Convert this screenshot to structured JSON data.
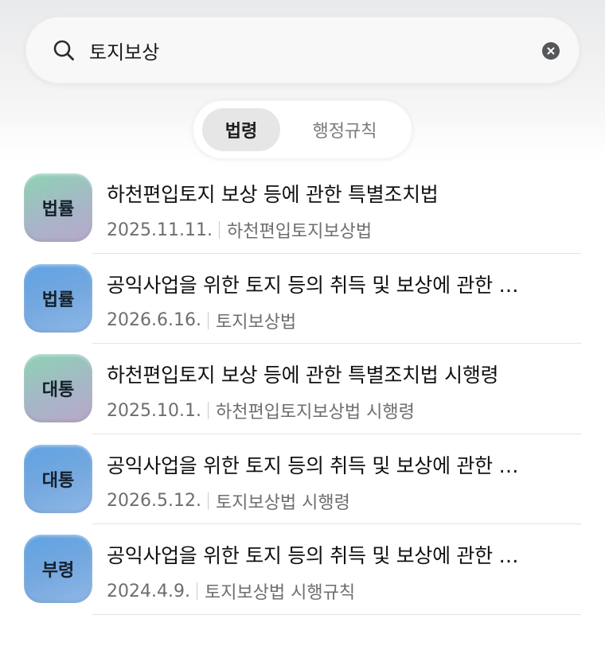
{
  "search": {
    "value": "토지보상",
    "placeholder": ""
  },
  "tabs": [
    {
      "label": "법령",
      "selected": true
    },
    {
      "label": "행정규칙",
      "selected": false
    }
  ],
  "results": [
    {
      "badge": "법률",
      "badge_color": "green",
      "title": "하천편입토지 보상 등에 관한 특별조치법",
      "date": "2025.11.11.",
      "short_name": "하천편입토지보상법"
    },
    {
      "badge": "법률",
      "badge_color": "blue",
      "title": "공익사업을 위한 토지 등의 취득 및 보상에 관한 …",
      "date": "2026.6.16.",
      "short_name": "토지보상법"
    },
    {
      "badge": "대통",
      "badge_color": "green",
      "title": "하천편입토지 보상 등에 관한 특별조치법 시행령",
      "date": "2025.10.1.",
      "short_name": "하천편입토지보상법 시행령"
    },
    {
      "badge": "대통",
      "badge_color": "blue",
      "title": "공익사업을 위한 토지 등의 취득 및 보상에 관한 …",
      "date": "2026.5.12.",
      "short_name": "토지보상법 시행령"
    },
    {
      "badge": "부령",
      "badge_color": "blue",
      "title": "공익사업을 위한 토지 등의 취득 및 보상에 관한 …",
      "date": "2024.4.9.",
      "short_name": "토지보상법 시행규칙"
    }
  ],
  "icons": {
    "search": "search-icon",
    "clear": "clear-icon"
  }
}
